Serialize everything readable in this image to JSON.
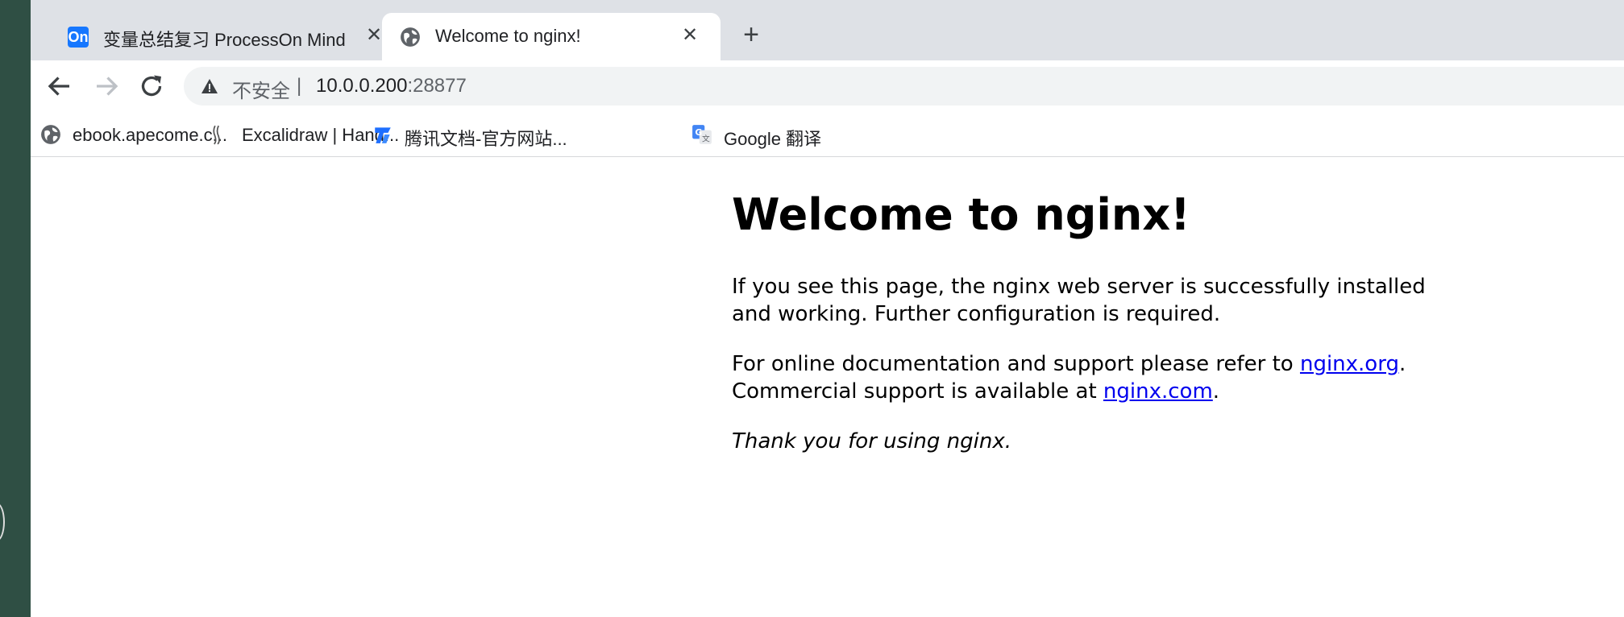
{
  "tabs": [
    {
      "favicon": "processon-logo-icon",
      "favicon_text": "On",
      "title": "变量总结复习 ProcessOn Mind"
    },
    {
      "favicon": "globe-icon",
      "title": "Welcome to nginx!"
    }
  ],
  "address_bar": {
    "security_label": "不安全",
    "separator": "|",
    "host": "10.0.0.200",
    "port": ":28877"
  },
  "bookmarks": [
    {
      "icon": "globe-icon",
      "label": "ebook.apecome.c..."
    },
    {
      "icon": "excalidraw-icon",
      "label": "Excalidraw | Hand..."
    },
    {
      "icon": "tencent-docs-icon",
      "label": "腾讯文档-官方网站..."
    },
    {
      "icon": "google-translate-icon",
      "label": "Google 翻译"
    }
  ],
  "page": {
    "heading": "Welcome to nginx!",
    "para1": "If you see this page, the nginx web server is successfully installed and working. Further configuration is required.",
    "para2_prefix": "For online documentation and support please refer to ",
    "link_org": "nginx.org",
    "para2_mid": ".",
    "para2_line2_prefix": "Commercial support is available at ",
    "link_com": "nginx.com",
    "para2_end": ".",
    "thanks": "Thank you for using nginx."
  },
  "colors": {
    "tabstrip_bg": "#dee1e6",
    "omnibox_bg": "#f1f3f4",
    "link": "#0000ee",
    "processon_blue": "#1677ff"
  }
}
